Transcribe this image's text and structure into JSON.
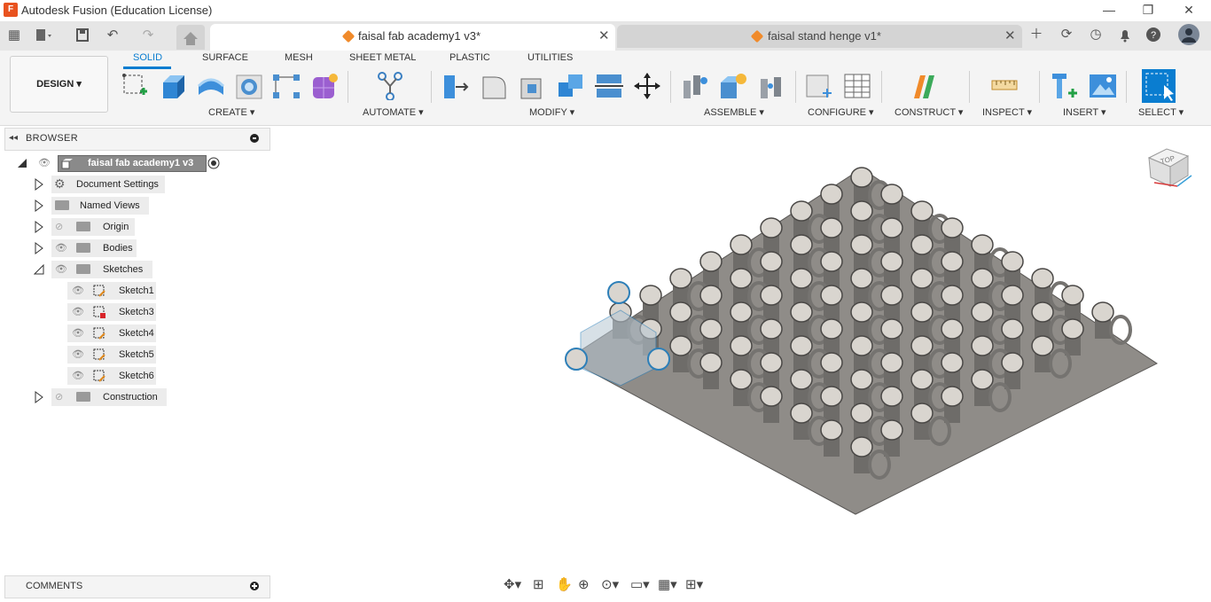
{
  "window": {
    "title": "Autodesk Fusion (Education License)",
    "logo_letter": "F",
    "minimize": "—",
    "maximize": "❐",
    "close": "✕"
  },
  "tabs": [
    {
      "label": "faisal fab academy1 v3*",
      "active": true,
      "close": "✕"
    },
    {
      "label": "faisal stand henge v1*",
      "active": false,
      "close": "✕"
    }
  ],
  "toolbar": {
    "workspace": "DESIGN ▾",
    "tabs": [
      "SOLID",
      "SURFACE",
      "MESH",
      "SHEET METAL",
      "PLASTIC",
      "UTILITIES"
    ],
    "groups": [
      {
        "label": "CREATE ▾",
        "icons": [
          "create-sketch-icon",
          "extrude-icon",
          "revolve-icon",
          "hole-icon",
          "pattern-icon",
          "form-icon"
        ]
      },
      {
        "label": "AUTOMATE ▾",
        "icons": [
          "automate-icon"
        ]
      },
      {
        "label": "MODIFY ▾",
        "icons": [
          "press-pull-icon",
          "fillet-icon",
          "shell-icon",
          "combine-icon",
          "split-body-icon",
          "move-icon"
        ]
      },
      {
        "label": "ASSEMBLE ▾",
        "icons": [
          "joint-icon",
          "new-component-icon",
          "as-built-joint-icon"
        ]
      },
      {
        "label": "CONFIGURE ▾",
        "icons": [
          "parameters-icon",
          "configure-table-icon"
        ]
      },
      {
        "label": "CONSTRUCT ▾",
        "icons": [
          "offset-plane-icon"
        ]
      },
      {
        "label": "INSPECT ▾",
        "icons": [
          "measure-icon"
        ]
      },
      {
        "label": "INSERT ▾",
        "icons": [
          "insert-mcmaster-icon",
          "insert-image-icon"
        ]
      },
      {
        "label": "SELECT ▾",
        "icons": [
          "select-icon"
        ]
      }
    ],
    "accent_color": "#0a7dd0"
  },
  "browser": {
    "title": "BROWSER",
    "root": "faisal fab academy1 v3",
    "items": [
      {
        "label": "Document Settings",
        "icon": "gear-icon"
      },
      {
        "label": "Named Views",
        "icon": "folder-icon"
      },
      {
        "label": "Origin",
        "icon": "folder-icon",
        "hidden": true
      },
      {
        "label": "Bodies",
        "icon": "folder-icon"
      },
      {
        "label": "Sketches",
        "icon": "folder-icon",
        "expanded": true
      },
      {
        "label": "Sketch1",
        "icon": "sketch-icon"
      },
      {
        "label": "Sketch3",
        "icon": "sketch-icon",
        "error": true
      },
      {
        "label": "Sketch4",
        "icon": "sketch-icon"
      },
      {
        "label": "Sketch5",
        "icon": "sketch-icon"
      },
      {
        "label": "Sketch6",
        "icon": "sketch-icon"
      },
      {
        "label": "Construction",
        "icon": "folder-icon",
        "hidden": true
      }
    ]
  },
  "comments": {
    "title": "COMMENTS"
  },
  "viewcube": {
    "face": "TOP"
  }
}
